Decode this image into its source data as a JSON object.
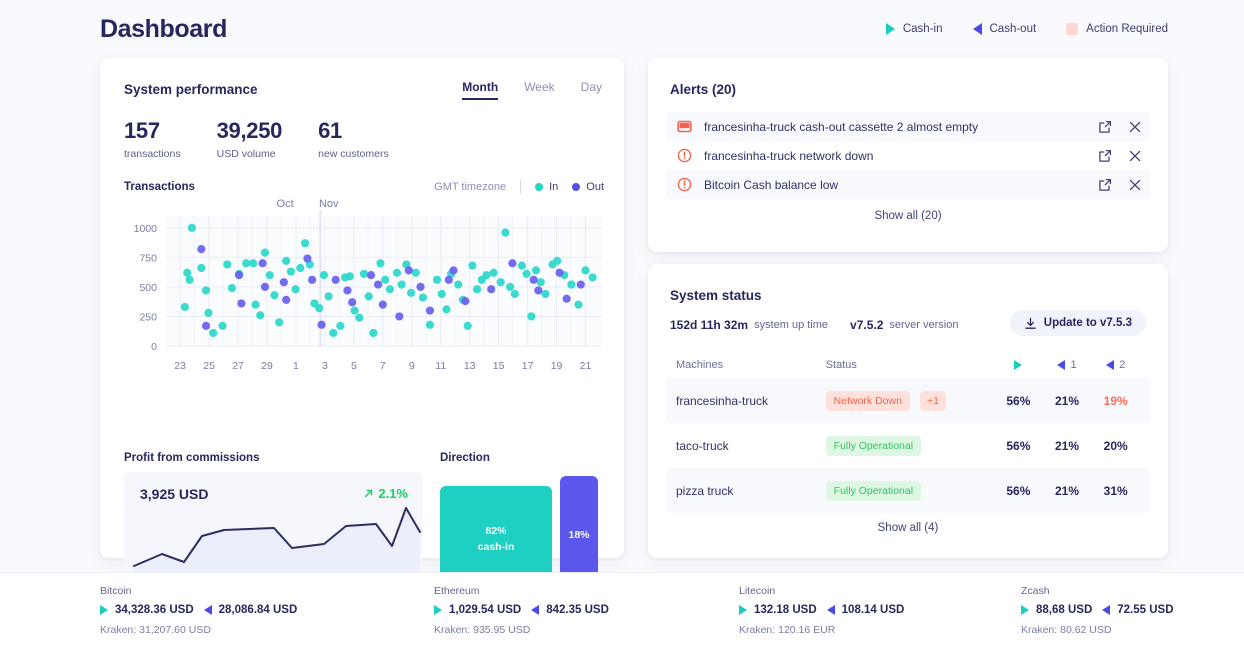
{
  "header": {
    "title": "Dashboard",
    "legend": [
      {
        "label": "Cash-in",
        "icon": "triangle-right-icon",
        "color": "#18cfbe"
      },
      {
        "label": "Cash-out",
        "icon": "triangle-left-icon",
        "color": "#4a4ae8"
      },
      {
        "label": "Action Required",
        "icon": "square-icon",
        "color": "#ffd8d3"
      }
    ]
  },
  "performance": {
    "title": "System performance",
    "tabs": [
      {
        "label": "Month",
        "active": true
      },
      {
        "label": "Week",
        "active": false
      },
      {
        "label": "Day",
        "active": false
      }
    ],
    "stats": [
      {
        "value": "157",
        "label": "transactions"
      },
      {
        "value": "39,250",
        "label": "USD volume"
      },
      {
        "value": "61",
        "label": "new customers"
      }
    ],
    "transactions": {
      "title": "Transactions",
      "timezone": "GMT timezone",
      "legend": [
        {
          "label": "In",
          "color": "#1ed6c4"
        },
        {
          "label": "Out",
          "color": "#5250e8"
        }
      ]
    },
    "profit": {
      "title": "Profit from commissions",
      "value": "3,925 USD",
      "change": "2.1%",
      "change_direction": "up",
      "change_color": "#18cf5a"
    },
    "direction": {
      "title": "Direction",
      "cash_in_pct": "82%",
      "cash_in_label": "cash-in",
      "cash_out_pct": "18%",
      "cash_in_color": "#1dd0c1",
      "cash_out_color": "#5b56ec"
    }
  },
  "chart_data": {
    "type": "scatter",
    "title": "Transactions",
    "xlabel": "",
    "ylabel": "",
    "ylim": [
      0,
      1100
    ],
    "yticks": [
      0,
      250,
      500,
      750,
      1000
    ],
    "grid": true,
    "legend_position": "top-right",
    "month_markers": [
      {
        "label": "Oct",
        "x": 9.2
      },
      {
        "label": "Nov",
        "x": 10.6
      }
    ],
    "xticks": [
      "23",
      "25",
      "27",
      "29",
      "1",
      "3",
      "5",
      "7",
      "9",
      "11",
      "13",
      "15",
      "17",
      "19",
      "21"
    ],
    "series": [
      {
        "name": "In",
        "color": "#2fd9cb",
        "points": [
          [
            0.5,
            1000
          ],
          [
            0.3,
            620
          ],
          [
            0.4,
            560
          ],
          [
            0.2,
            330
          ],
          [
            0.9,
            660
          ],
          [
            1.1,
            470
          ],
          [
            1.2,
            280
          ],
          [
            1.4,
            110
          ],
          [
            1.8,
            170
          ],
          [
            2.0,
            690
          ],
          [
            2.2,
            490
          ],
          [
            2.5,
            610
          ],
          [
            2.8,
            700
          ],
          [
            3.1,
            700
          ],
          [
            3.2,
            350
          ],
          [
            3.4,
            260
          ],
          [
            3.6,
            790
          ],
          [
            3.8,
            600
          ],
          [
            4.0,
            430
          ],
          [
            4.2,
            200
          ],
          [
            4.5,
            720
          ],
          [
            4.7,
            630
          ],
          [
            4.9,
            480
          ],
          [
            5.1,
            660
          ],
          [
            5.3,
            870
          ],
          [
            5.5,
            690
          ],
          [
            5.7,
            360
          ],
          [
            5.9,
            320
          ],
          [
            6.1,
            600
          ],
          [
            6.3,
            420
          ],
          [
            6.5,
            110
          ],
          [
            6.8,
            170
          ],
          [
            7.0,
            580
          ],
          [
            7.2,
            590
          ],
          [
            7.4,
            300
          ],
          [
            7.6,
            240
          ],
          [
            7.8,
            610
          ],
          [
            8.0,
            420
          ],
          [
            8.2,
            110
          ],
          [
            8.5,
            700
          ],
          [
            8.7,
            560
          ],
          [
            8.9,
            480
          ],
          [
            9.2,
            620
          ],
          [
            9.4,
            520
          ],
          [
            9.6,
            690
          ],
          [
            9.8,
            450
          ],
          [
            10.0,
            620
          ],
          [
            10.3,
            410
          ],
          [
            10.6,
            180
          ],
          [
            10.9,
            560
          ],
          [
            11.1,
            440
          ],
          [
            11.3,
            310
          ],
          [
            11.5,
            610
          ],
          [
            11.8,
            520
          ],
          [
            12.0,
            390
          ],
          [
            12.2,
            170
          ],
          [
            12.4,
            680
          ],
          [
            12.6,
            480
          ],
          [
            12.8,
            560
          ],
          [
            13.0,
            600
          ],
          [
            13.3,
            620
          ],
          [
            13.6,
            540
          ],
          [
            13.8,
            960
          ],
          [
            14.0,
            500
          ],
          [
            14.2,
            440
          ],
          [
            14.5,
            680
          ],
          [
            14.7,
            610
          ],
          [
            14.9,
            250
          ],
          [
            15.1,
            640
          ],
          [
            15.3,
            540
          ],
          [
            15.5,
            440
          ],
          [
            15.8,
            690
          ],
          [
            16.0,
            720
          ],
          [
            16.3,
            600
          ],
          [
            16.6,
            520
          ],
          [
            16.9,
            350
          ],
          [
            17.2,
            640
          ],
          [
            17.5,
            580
          ]
        ]
      },
      {
        "name": "Out",
        "color": "#6b63ef",
        "points": [
          [
            0.9,
            820
          ],
          [
            1.1,
            170
          ],
          [
            2.5,
            600
          ],
          [
            2.6,
            360
          ],
          [
            3.5,
            700
          ],
          [
            3.6,
            500
          ],
          [
            4.4,
            540
          ],
          [
            4.5,
            390
          ],
          [
            5.4,
            740
          ],
          [
            5.6,
            560
          ],
          [
            6.0,
            180
          ],
          [
            6.6,
            560
          ],
          [
            7.1,
            470
          ],
          [
            7.3,
            370
          ],
          [
            8.1,
            600
          ],
          [
            8.4,
            520
          ],
          [
            8.6,
            350
          ],
          [
            9.3,
            250
          ],
          [
            9.7,
            640
          ],
          [
            10.2,
            500
          ],
          [
            10.6,
            300
          ],
          [
            11.4,
            560
          ],
          [
            11.6,
            640
          ],
          [
            12.1,
            380
          ],
          [
            13.2,
            480
          ],
          [
            14.1,
            700
          ],
          [
            15.0,
            560
          ],
          [
            15.2,
            470
          ],
          [
            16.1,
            620
          ],
          [
            16.4,
            400
          ],
          [
            17.0,
            520
          ]
        ]
      }
    ]
  },
  "alerts": {
    "title": "Alerts (20)",
    "show_all": "Show all (20)",
    "items": [
      {
        "icon": "cassette-icon",
        "text": "francesinha-truck cash-out cassette 2 almost empty"
      },
      {
        "icon": "warning-circle-icon",
        "text": "francesinha-truck network down"
      },
      {
        "icon": "warning-circle-icon",
        "text": "Bitcoin Cash balance low"
      }
    ]
  },
  "system_status": {
    "title": "System status",
    "uptime_value": "152d 11h 32m",
    "uptime_label": "system up time",
    "version_value": "v7.5.2",
    "version_label": "server version",
    "update_button": "Update to v7.5.3",
    "columns": {
      "machines": "Machines",
      "status": "Status",
      "col_cashin": "",
      "col_1": "1",
      "col_2": "2"
    },
    "rows": [
      {
        "machine": "francesinha-truck",
        "status_label": "Network Down",
        "status_kind": "down",
        "status_extra": "+1",
        "p1": "56%",
        "p2": "21%",
        "p3": "19%",
        "p3_warn": true
      },
      {
        "machine": "taco-truck",
        "status_label": "Fully Operational",
        "status_kind": "ok",
        "status_extra": "",
        "p1": "56%",
        "p2": "21%",
        "p3": "20%",
        "p3_warn": false
      },
      {
        "machine": "pizza truck",
        "status_label": "Fully Operational",
        "status_kind": "ok",
        "status_extra": "",
        "p1": "56%",
        "p2": "21%",
        "p3": "31%",
        "p3_warn": false
      }
    ],
    "show_all": "Show all (4)"
  },
  "ticker": [
    {
      "name": "Bitcoin",
      "cash_in": "34,328.36 USD",
      "cash_out": "28,086.84 USD",
      "kraken": "Kraken: 31,207.60 USD"
    },
    {
      "name": "Ethereum",
      "cash_in": "1,029.54 USD",
      "cash_out": "842.35 USD",
      "kraken": "Kraken: 935.95 USD"
    },
    {
      "name": "Litecoin",
      "cash_in": "132.18 USD",
      "cash_out": "108.14 USD",
      "kraken": "Kraken: 120.16 EUR"
    },
    {
      "name": "Zcash",
      "cash_in": "88,68 USD",
      "cash_out": "72.55 USD",
      "kraken": "Kraken: 80.62 USD"
    }
  ]
}
